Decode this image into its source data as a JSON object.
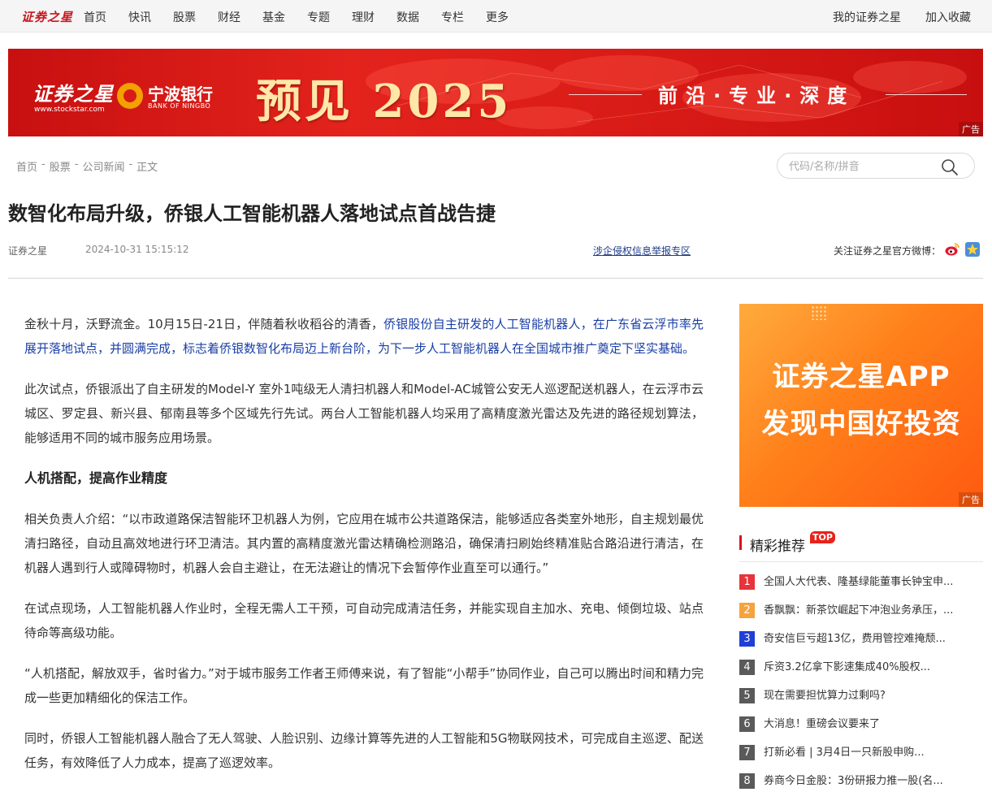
{
  "topnav": {
    "logo": "证券之星",
    "items": [
      "首页",
      "快讯",
      "股票",
      "财经",
      "基金",
      "专题",
      "理财",
      "数据",
      "专栏",
      "更多"
    ],
    "right": [
      "我的证券之星",
      "加入收藏"
    ]
  },
  "banner": {
    "logo": "证券之星",
    "url": "www.stockstar.com",
    "bank_name": "宁波银行",
    "bank_en": "BANK OF NINGBO",
    "headline": "预见 2025",
    "slogan": "前沿·专业·深度",
    "ad_label": "广告"
  },
  "breadcrumb": [
    "首页",
    "股票",
    "公司新闻",
    "正文"
  ],
  "breadcrumb_sep": "-",
  "search": {
    "placeholder": "代码/名称/拼音"
  },
  "article": {
    "title": "数智化布局升级，侨银人工智能机器人落地试点首战告捷",
    "source": "证券之星",
    "time": "2024-10-31 15:15:12",
    "report_link": "涉企侵权信息举报专区",
    "follow_text": "关注证券之星官方微博：",
    "p1_plain": "金秋十月，沃野流金。10月15日-21日，伴随着秋收稻谷的清香，",
    "p1_link": "侨银股份自主研发的人工智能机器人，在广东省云浮市率先展开落地试点，并圆满完成，标志着侨银数智化布局迈上新台阶，为下一步人工智能机器人在全国城市推广奠定下坚实基础。",
    "p2": "此次试点，侨银派出了自主研发的Model-Y 室外1吨级无人清扫机器人和Model-AC城管公安无人巡逻配送机器人，在云浮市云城区、罗定县、新兴县、郁南县等多个区域先行先试。两台人工智能机器人均采用了高精度激光雷达及先进的路径规划算法，能够适用不同的城市服务应用场景。",
    "subhead": "人机搭配，提高作业精度",
    "p3": "相关负责人介绍：“以市政道路保洁智能环卫机器人为例，它应用在城市公共道路保洁，能够适应各类室外地形，自主规划最优清扫路径，自动且高效地进行环卫清洁。其内置的高精度激光雷达精确检测路沿，确保清扫刷始终精准贴合路沿进行清洁，在机器人遇到行人或障碍物时，机器人会自主避让，在无法避让的情况下会暂停作业直至可以通行。”",
    "p4": "在试点现场，人工智能机器人作业时，全程无需人工干预，可自动完成清洁任务，并能实现自主加水、充电、倾倒垃圾、站点待命等高级功能。",
    "p5": "“人机搭配，解放双手，省时省力。”对于城市服务工作者王师傅来说，有了智能“小帮手”协同作业，自己可以腾出时间和精力完成一些更加精细化的保洁工作。",
    "p6": "同时，侨银人工智能机器人融合了无人驾驶、人脸识别、边缘计算等先进的人工智能和5G物联网技术，可完成自主巡逻、配送任务，有效降低了人力成本，提高了巡逻效率。"
  },
  "side_ad": {
    "line1": "证券之星APP",
    "line2": "发现中国好投资",
    "ad_label": "广告"
  },
  "recommend": {
    "title": "精彩推荐",
    "badge": "TOP",
    "items": [
      {
        "num": "1",
        "text": "全国人大代表、隆基绿能董事长钟宝申..."
      },
      {
        "num": "2",
        "text": "香飘飘：新茶饮崛起下冲泡业务承压，..."
      },
      {
        "num": "3",
        "text": "奇安信巨亏超13亿，费用管控难掩颓..."
      },
      {
        "num": "4",
        "text": "斥资3.2亿拿下影速集成40%股权..."
      },
      {
        "num": "5",
        "text": "现在需要担忧算力过剩吗?"
      },
      {
        "num": "6",
        "text": "大消息！重磅会议要来了"
      },
      {
        "num": "7",
        "text": "打新必看 | 3月4日一只新股申购..."
      },
      {
        "num": "8",
        "text": "券商今日金股：3份研报力推一股(名..."
      }
    ],
    "colors": [
      "#e8333a",
      "#f5a33c",
      "#1f3fd6",
      "#5a5a5a",
      "#5a5a5a",
      "#5a5a5a",
      "#5a5a5a",
      "#5a5a5a"
    ]
  },
  "colors": {
    "brand_red": "#c8161d",
    "link_blue": "#1a3fa6",
    "ad_orange": "#ff7f1a"
  }
}
